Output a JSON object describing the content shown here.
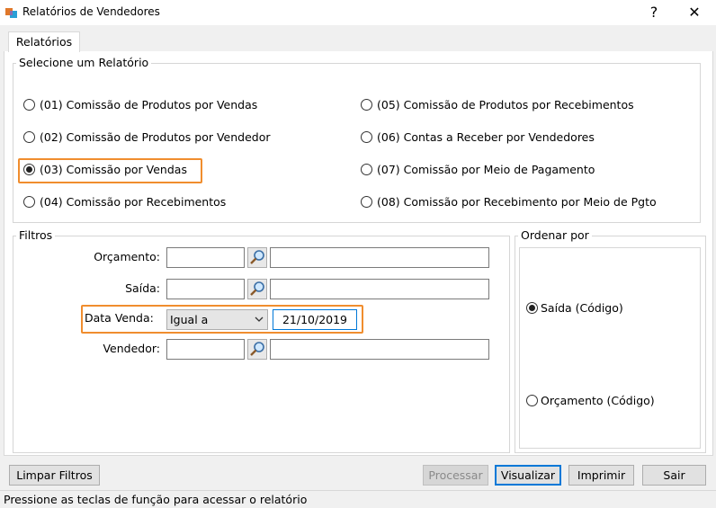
{
  "window": {
    "title": "Relatórios de Vendedores",
    "help_glyph": "?",
    "close_glyph": "✕"
  },
  "tab": {
    "label": "Relatórios"
  },
  "reports": {
    "group_label": "Selecione um Relatório",
    "options": [
      {
        "label": "(01) Comissão de Produtos por Vendas",
        "checked": false
      },
      {
        "label": "(02) Comissão de Produtos por Vendedor",
        "checked": false
      },
      {
        "label": "(03) Comissão por Vendas",
        "checked": true
      },
      {
        "label": "(04) Comissão por Recebimentos",
        "checked": false
      },
      {
        "label": "(05) Comissão de Produtos por Recebimentos",
        "checked": false
      },
      {
        "label": "(06) Contas a Receber por Vendedores",
        "checked": false
      },
      {
        "label": "(07) Comissão por Meio de Pagamento",
        "checked": false
      },
      {
        "label": "(08) Comissão por Recebimento por Meio de Pgto",
        "checked": false
      }
    ]
  },
  "filters": {
    "group_label": "Filtros",
    "orcamento": {
      "label": "Orçamento:",
      "code": "",
      "description": ""
    },
    "saida": {
      "label": "Saída:",
      "code": "",
      "description": ""
    },
    "data_venda": {
      "label": "Data Venda:",
      "operator": "Igual a",
      "value": "21/10/2019"
    },
    "vendedor": {
      "label": "Vendedor:",
      "code": "",
      "description": ""
    }
  },
  "order": {
    "group_label": "Ordenar por",
    "options": [
      {
        "label": "Saída (Código)",
        "checked": true
      },
      {
        "label": "Orçamento (Código)",
        "checked": false
      }
    ]
  },
  "buttons": {
    "limpar": "Limpar Filtros",
    "processar": "Processar",
    "visualizar": "Visualizar",
    "imprimir": "Imprimir",
    "sair": "Sair"
  },
  "status": {
    "text": "Pressione as teclas de função para acessar o relatório"
  },
  "colors": {
    "highlight": "#f08d2e",
    "focus": "#0078d7"
  }
}
